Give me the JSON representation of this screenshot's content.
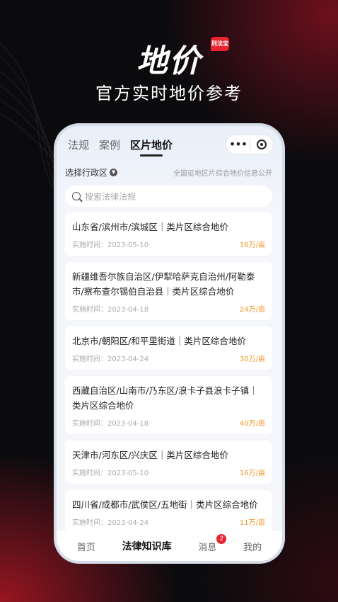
{
  "hero": {
    "title": "地价",
    "brand_badge": "刑法宝",
    "subtitle": "官方实时地价参考"
  },
  "tabs": [
    {
      "label": "法规",
      "active": false
    },
    {
      "label": "案例",
      "active": false
    },
    {
      "label": "区片地价",
      "active": true
    }
  ],
  "capsule": {
    "more_icon": "more-dots-icon",
    "close_icon": "target-icon"
  },
  "filter": {
    "region_label": "选择行政区",
    "notice": "全国征地区片综合地价信息公开"
  },
  "search": {
    "placeholder": "搜索法律法规"
  },
  "items": [
    {
      "title": "山东省/滨州市/滨城区｜类片区综合地价",
      "date_label": "实施时间：2023-05-10",
      "price": "16万/亩"
    },
    {
      "title": "新疆维吾尔族自治区/伊犁哈萨克自治州/阿勒泰市/察布查尔锡伯自治县｜类片区综合地价",
      "date_label": "实施时间：2023-04-18",
      "price": "24万/亩"
    },
    {
      "title": "北京市/朝阳区/和平里街道｜类片区综合地价",
      "date_label": "实施时间：2023-04-24",
      "price": "30万/亩"
    },
    {
      "title": "西藏自治区/山南市/乃东区/浪卡子县浪卡子镇｜类片区综合地价",
      "date_label": "实施时间：2023-04-18",
      "price": "40万/亩"
    },
    {
      "title": "天津市/河东区/兴庆区｜类片区综合地价",
      "date_label": "实施时间：2023-05-10",
      "price": "16万/亩"
    },
    {
      "title": "四川省/成都市/武侯区/五地街｜类片区综合地价",
      "date_label": "实施时间：2023-04-24",
      "price": "11万/亩"
    }
  ],
  "bottom_nav": [
    {
      "label": "首页",
      "active": false
    },
    {
      "label": "法律知识库",
      "active": true
    },
    {
      "label": "消息",
      "active": false,
      "badge": "2"
    },
    {
      "label": "我的",
      "active": false
    }
  ],
  "colors": {
    "accent": "#e8242f",
    "price": "#f29424"
  }
}
